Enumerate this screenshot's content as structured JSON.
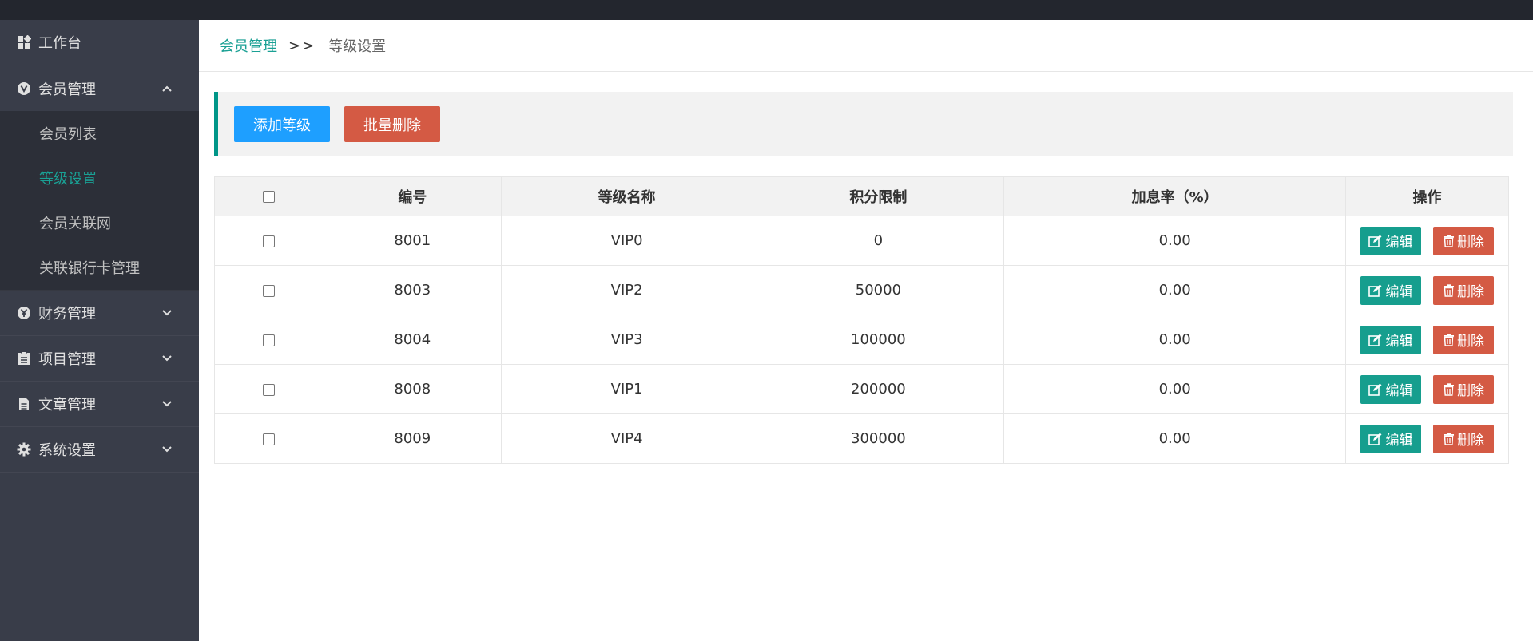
{
  "sidebar": {
    "items": [
      {
        "label": "工作台",
        "icon": "dashboard-icon"
      },
      {
        "label": "会员管理",
        "icon": "vip-icon",
        "expanded": true,
        "children": [
          {
            "label": "会员列表"
          },
          {
            "label": "等级设置",
            "active": true
          },
          {
            "label": "会员关联网"
          },
          {
            "label": "关联银行卡管理"
          }
        ]
      },
      {
        "label": "财务管理",
        "icon": "yen-icon"
      },
      {
        "label": "项目管理",
        "icon": "clipboard-icon"
      },
      {
        "label": "文章管理",
        "icon": "document-icon"
      },
      {
        "label": "系统设置",
        "icon": "gear-icon"
      }
    ]
  },
  "breadcrumb": {
    "parent": "会员管理",
    "separator": ">>",
    "current": "等级设置"
  },
  "toolbar": {
    "add_label": "添加等级",
    "batch_delete_label": "批量删除"
  },
  "table": {
    "headers": [
      "",
      "编号",
      "等级名称",
      "积分限制",
      "加息率（%）",
      "操作"
    ],
    "rows": [
      {
        "id": "8001",
        "name": "VIP0",
        "points": "0",
        "rate": "0.00"
      },
      {
        "id": "8003",
        "name": "VIP2",
        "points": "50000",
        "rate": "0.00"
      },
      {
        "id": "8004",
        "name": "VIP3",
        "points": "100000",
        "rate": "0.00"
      },
      {
        "id": "8008",
        "name": "VIP1",
        "points": "200000",
        "rate": "0.00"
      },
      {
        "id": "8009",
        "name": "VIP4",
        "points": "300000",
        "rate": "0.00"
      }
    ],
    "edit_label": "编辑",
    "delete_label": "删除"
  },
  "colors": {
    "accent": "#1aa094",
    "primary_blue": "#1e9fff",
    "danger": "#d45a44",
    "sidebar_bg": "#393d49"
  }
}
